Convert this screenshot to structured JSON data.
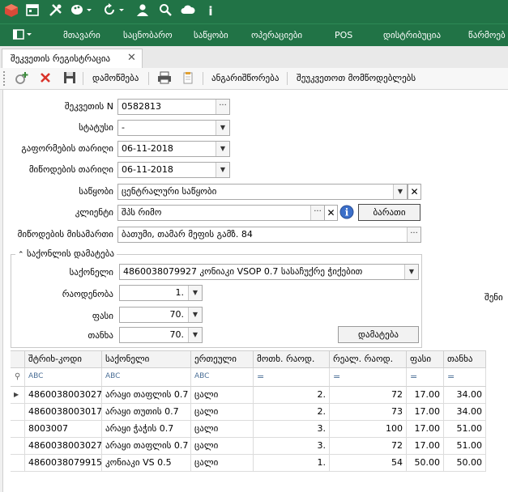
{
  "topbar": {
    "icons": [
      "logo-icon",
      "calendar-icon",
      "tools-icon",
      "palette-icon",
      "refresh-icon",
      "user-icon",
      "search-icon",
      "cloud-icon",
      "info-icon"
    ]
  },
  "menu": {
    "items": [
      "მთავარი",
      "საცნობარო",
      "საწყობი",
      "ოპერაციები",
      "POS",
      "დისტრიბუცია",
      "წარმოებ"
    ]
  },
  "tab": {
    "label": "შეკვეთის რეგისტრაცია",
    "close": "✕"
  },
  "toolbar": {
    "confirm_label": "დამოწმება",
    "calculate_label": "ანგარიშწორება",
    "notify_label": "შეუკვეთოთ მომწოდებლებს"
  },
  "form": {
    "order_no": {
      "label": "შეკვეთის N",
      "value": "0582813"
    },
    "status": {
      "label": "სტატუსი",
      "value": "-"
    },
    "issue_date": {
      "label": "გაფორმების თარიღი",
      "value": "06-11-2018"
    },
    "delivery_date": {
      "label": "მიწოდების თარიღი",
      "value": "06-11-2018"
    },
    "warehouse": {
      "label": "საწყობი",
      "value": "ცენტრალური საწყობი"
    },
    "client": {
      "label": "კლიენტი",
      "value": "შპს რიმო",
      "card_button": "ბარათი"
    },
    "address": {
      "label": "მიწოდების მისამართი",
      "value": "ბათუმი, თამარ მეფის გამზ. 84"
    },
    "side_label": "შენი"
  },
  "add_group": {
    "title": "საქონლის დამატება",
    "product": {
      "label": "საქონელი",
      "value": "4860038079927  კონიაკი VSOP 0.7 სასაჩუქრე ჭიქებით"
    },
    "quantity": {
      "label": "რაოდენობა",
      "value": "1."
    },
    "price": {
      "label": "ფასი",
      "value": "70."
    },
    "amount": {
      "label": "თანხა",
      "value": "70."
    },
    "add_button": "დამატება"
  },
  "grid": {
    "headers": [
      "შტრიხ-კოდი",
      "საქონელი",
      "ერთეული",
      "მოთხ. რაოდ.",
      "რეალ. რაოდ.",
      "ფასი",
      "თანხა"
    ],
    "filter_abc": "ABC",
    "filter_eq": "=",
    "filter_pin": "⚲",
    "rows": [
      [
        "4860038003027",
        "არაყი თაფლის 0.7",
        "ცალი",
        "2.",
        "72",
        "17.00",
        "34.00"
      ],
      [
        "4860038003017",
        "არაყი თუთის 0.7",
        "ცალი",
        "2.",
        "73",
        "17.00",
        "34.00"
      ],
      [
        "8003007",
        "არაყი ჭაჭის 0.7",
        "ცალი",
        "3.",
        "100",
        "17.00",
        "51.00"
      ],
      [
        "4860038003027",
        "არაყი თაფლის 0.7",
        "ცალი",
        "3.",
        "72",
        "17.00",
        "51.00"
      ],
      [
        "4860038079915",
        "კონიაკი VS 0.5",
        "ცალი",
        "1.",
        "54",
        "50.00",
        "50.00"
      ]
    ]
  }
}
